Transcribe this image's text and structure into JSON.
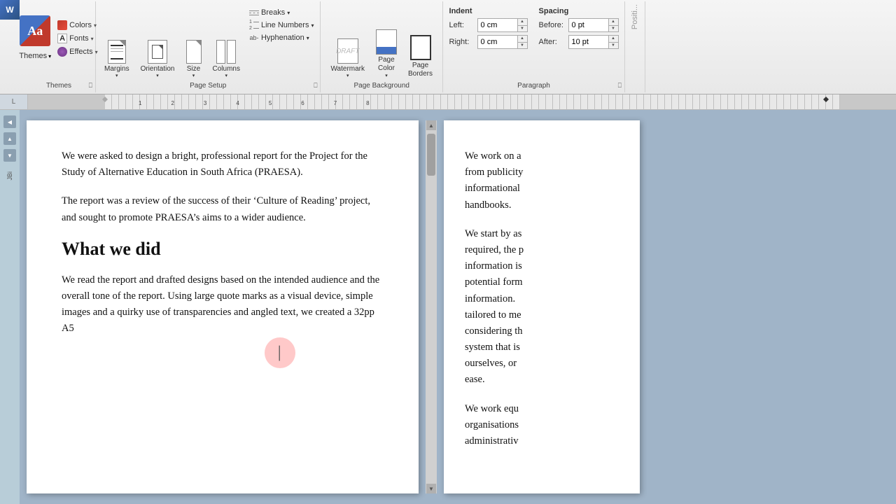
{
  "app": {
    "corner_label": "W"
  },
  "ribbon": {
    "themes_group": {
      "label": "Themes",
      "themes_btn_label": "Themes",
      "colors_label": "Colors",
      "fonts_label": "Fonts",
      "effects_label": "Effects"
    },
    "page_setup_group": {
      "label": "Page Setup",
      "margins_label": "Margins",
      "orientation_label": "Orientation",
      "size_label": "Size",
      "columns_label": "Columns",
      "breaks_label": "Breaks",
      "line_numbers_label": "Line Numbers",
      "hyphenation_label": "Hyphenation"
    },
    "page_bg_group": {
      "label": "Page Background",
      "watermark_label": "Watermark",
      "page_color_label": "Page\nColor",
      "page_borders_label": "Page\nBorders"
    },
    "paragraph_group": {
      "label": "Paragraph",
      "indent_label": "Indent",
      "left_label": "Left:",
      "right_label": "Right:",
      "left_value": "0 cm",
      "right_value": "0 cm",
      "spacing_label": "Spacing",
      "before_label": "Before:",
      "after_label": "After:",
      "before_value": "0 pt",
      "after_value": "10 pt"
    },
    "position_group": {
      "label": "Positi..."
    }
  },
  "document": {
    "page1": {
      "para1": "We were asked to design a bright, professional report for the Project for the Study of Alternative Education in South Africa (PRAESA).",
      "para2": "The report was a review of the success of their ‘Culture of Reading’ project, and sought to promote PRAESA’s aims to a wider audience.",
      "heading1": "What we did",
      "para3": "We read the report and drafted designs based on the intended audience and the overall tone of the report. Using large quote marks as a visual device, simple images and a quirky use of transparencies and angled text, we created a 32pp A5"
    },
    "page2": {
      "para1": "We work on a",
      "para1_cont": "from publicity",
      "para1_cont2": "informational",
      "para1_cont3": "handbooks.",
      "para2": "We start by as",
      "para2_cont": "required, the p",
      "para2_cont2": "information is",
      "para2_cont3": "potential form",
      "para2_cont4": "information.",
      "para2_cont5": "tailored to me",
      "para2_cont6": "considering th",
      "para2_cont7": "system that is",
      "para2_cont8": "ourselves, or",
      "para2_cont9": "ease.",
      "para3": "We work equ",
      "para3_cont": "organisations",
      "para3_cont2": "administrativ"
    }
  },
  "ruler": {
    "corner_label": "L"
  },
  "left_panel": {
    "jbi_label": "JBi"
  }
}
